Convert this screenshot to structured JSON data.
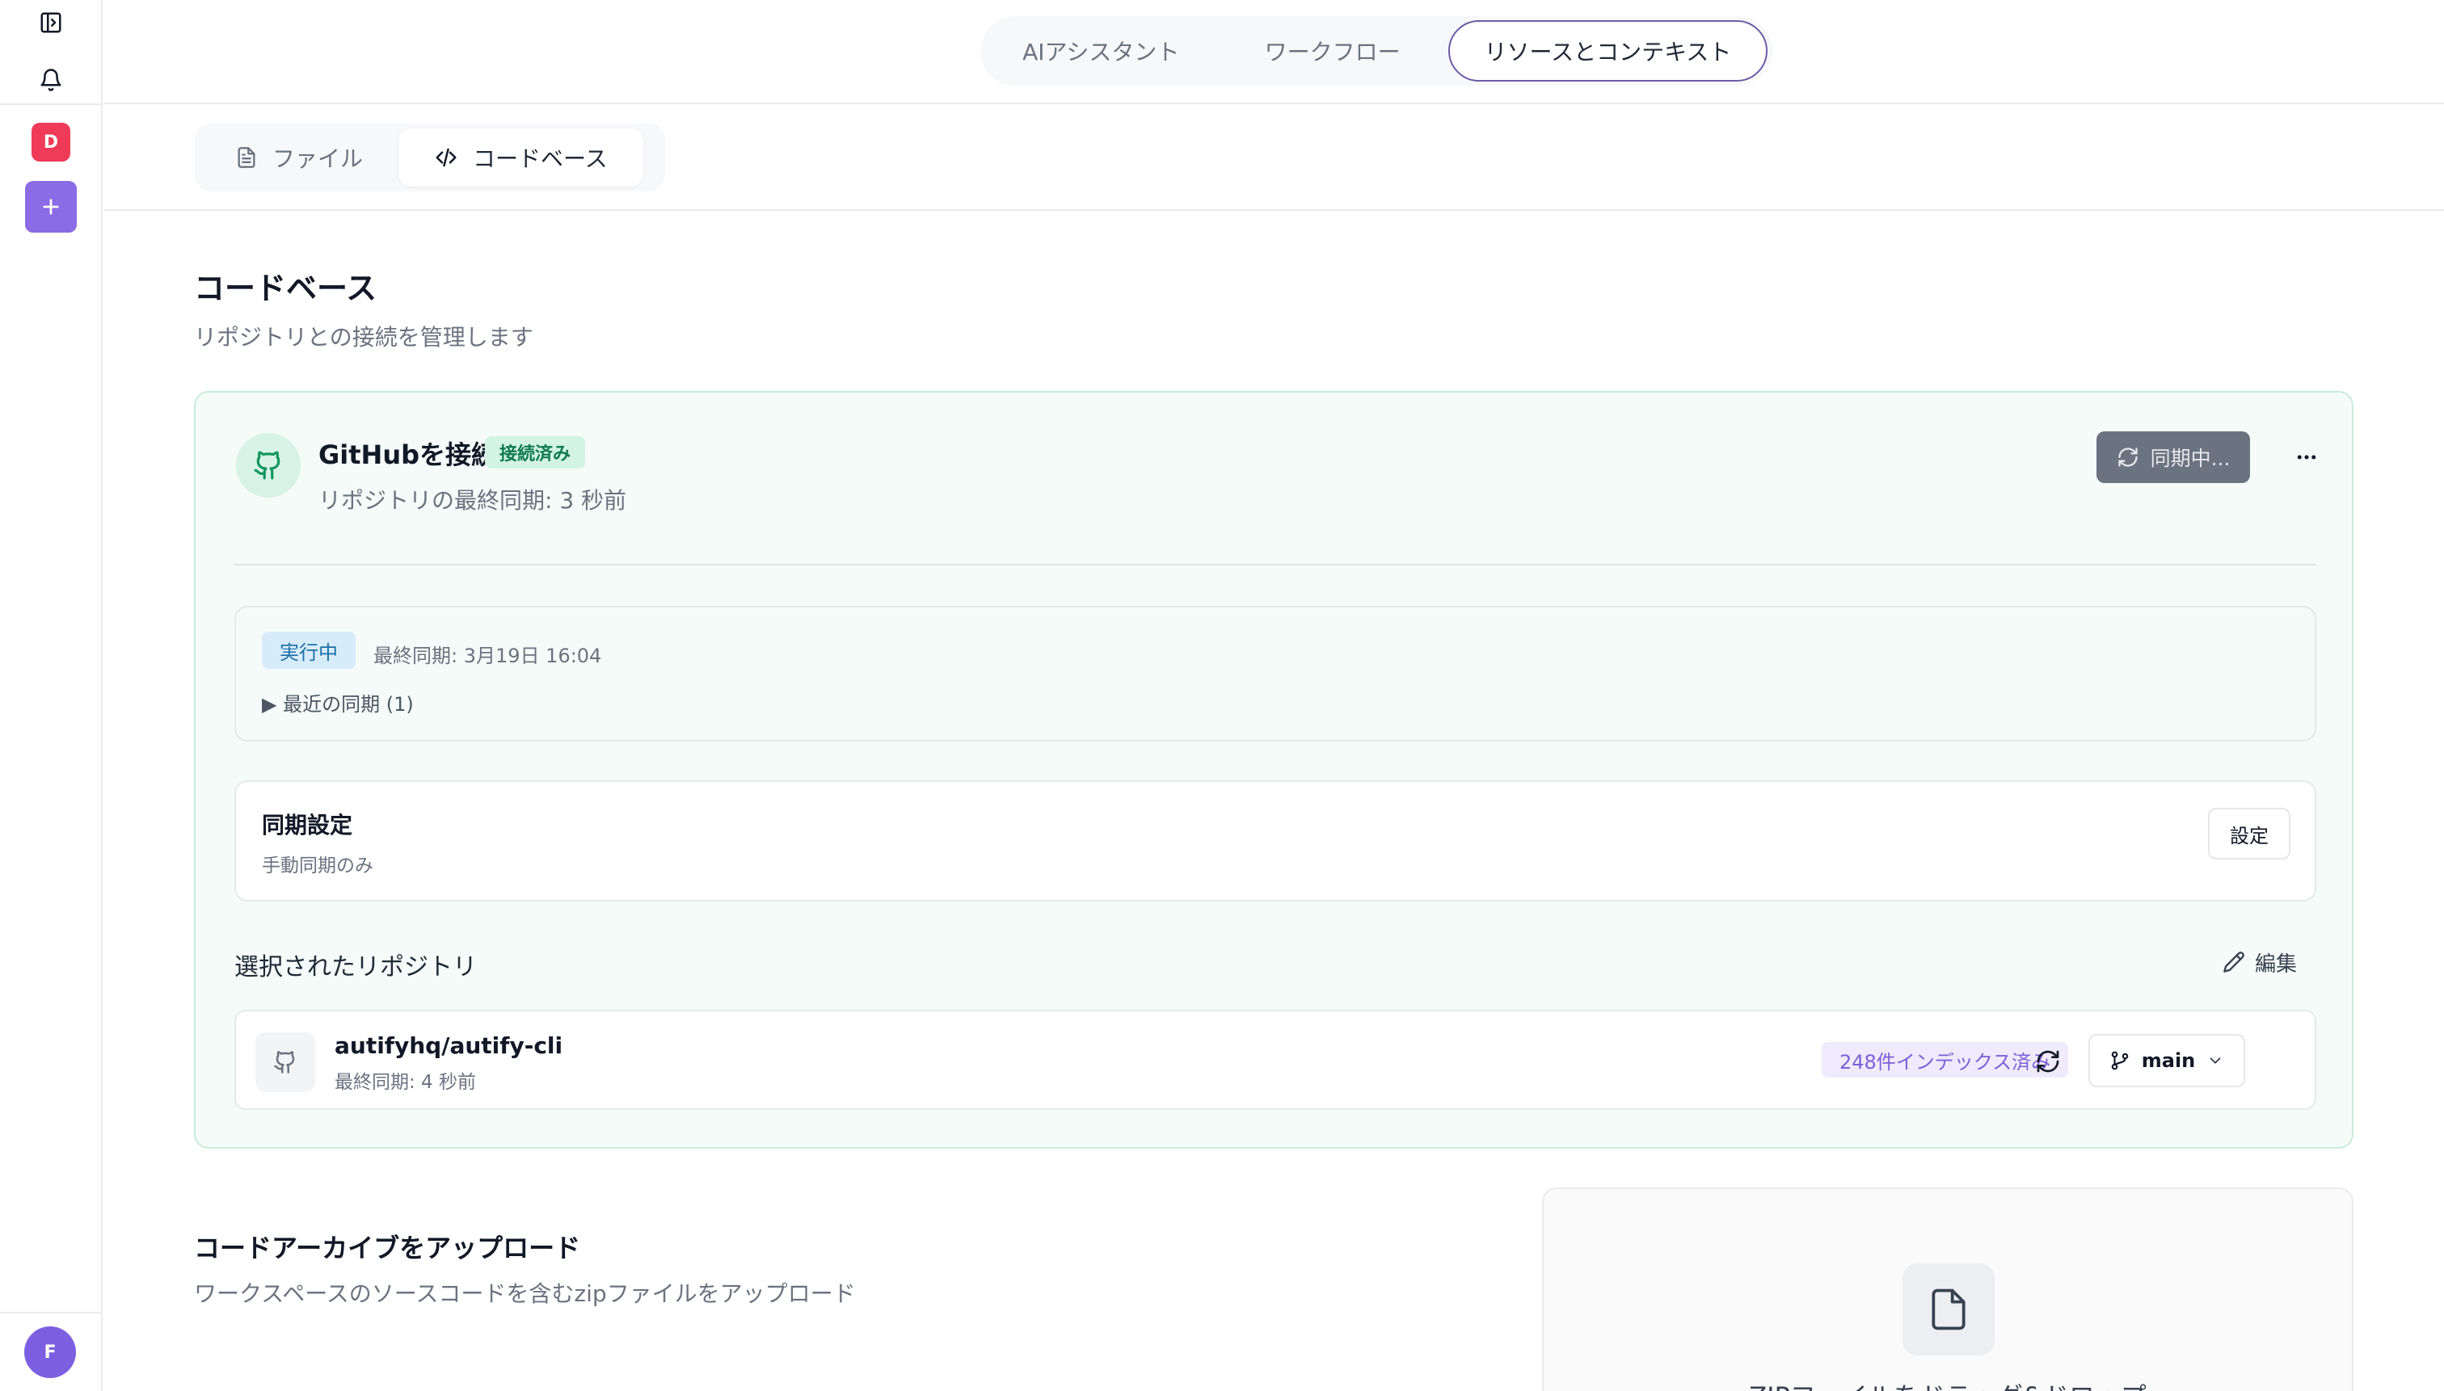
{
  "sidebar": {
    "workspace_initial": "D",
    "user_initial": "F",
    "colors": {
      "workspace": "#ef3b57",
      "add": "#8b6be6",
      "user": "#7c5fe0"
    },
    "icons": [
      "sidebar-toggle-icon",
      "bell-icon",
      "plus-icon"
    ]
  },
  "top_tabs": [
    {
      "label": "AIアシスタント",
      "active": false
    },
    {
      "label": "ワークフロー",
      "active": false
    },
    {
      "label": "リソースとコンテキスト",
      "active": true
    }
  ],
  "sub_tabs": [
    {
      "label": "ファイル",
      "icon": "file-icon",
      "active": false
    },
    {
      "label": "コードベース",
      "icon": "code-icon",
      "active": true
    }
  ],
  "page": {
    "title": "コードベース",
    "subtitle": "リポジトリとの接続を管理します"
  },
  "github": {
    "title": "GitHubを接続",
    "status_badge": "接続済み",
    "last_sync": "リポジトリの最終同期: 3 秒前",
    "sync_button": "同期中...",
    "run_status": "実行中",
    "run_last_sync": "最終同期: 3月19日 16:04",
    "recent_syncs": "▶ 最近の同期 (1)",
    "settings": {
      "title": "同期設定",
      "subtitle": "手動同期のみ",
      "button": "設定"
    },
    "repos_heading": "選択されたリポジトリ",
    "edit_label": "編集",
    "repos": [
      {
        "name": "autifyhq/autify-cli",
        "last_sync": "最終同期: 4 秒前",
        "indexed": "248件インデックス済み",
        "branch": "main"
      }
    ]
  },
  "archive": {
    "title": "コードアーカイブをアップロード",
    "subtitle": "ワークスペースのソースコードを含むzipファイルをアップロード",
    "drop_text": "ZIPファイルをドラッグ&ドロップ"
  }
}
